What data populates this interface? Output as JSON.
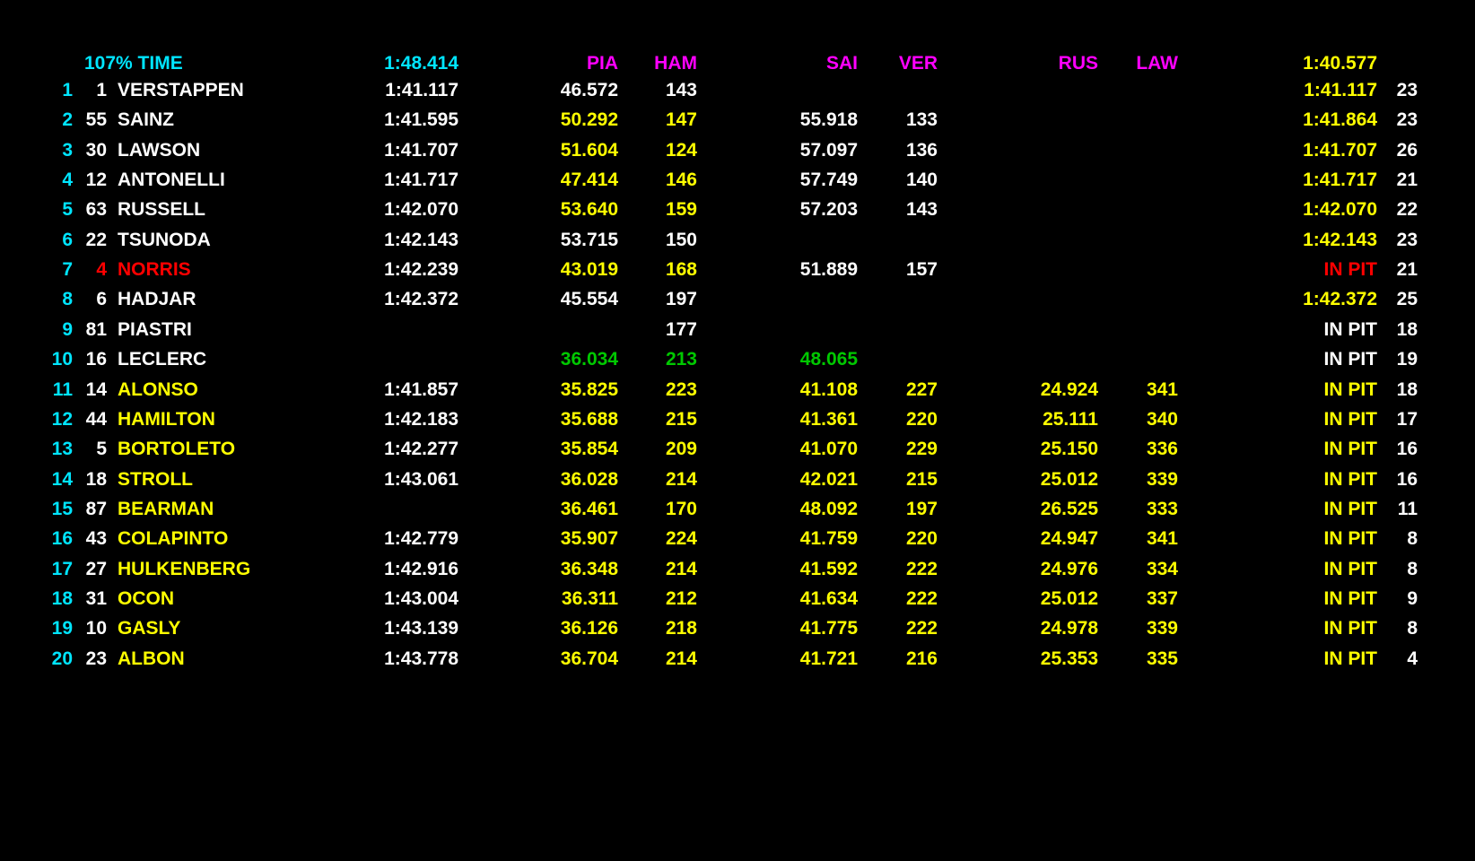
{
  "colors": {
    "white": "#ffffff",
    "yellow": "#ffff00",
    "cyan": "#00e5ff",
    "magenta": "#ff00ff",
    "red": "#ff0000",
    "green": "#00c800"
  },
  "header": {
    "title": "107% TIME",
    "lap_time": "1:48.414",
    "s1_driver": "PIA",
    "s1_speed_driver": "HAM",
    "s2_driver": "SAI",
    "s2_speed_driver": "VER",
    "s3_driver": "RUS",
    "s3_speed_driver": "LAW",
    "best_time": "1:40.577"
  },
  "rows": [
    {
      "pos": "1",
      "num": "1",
      "name": "VERSTAPPEN",
      "lap": "1:41.117",
      "s1": "46.572",
      "s1s": "143",
      "s2": "",
      "s2s": "",
      "s3": "",
      "s3s": "",
      "best": "1:41.117",
      "laps": "23",
      "c": {
        "name": "white",
        "lap": "white",
        "s1": "white",
        "s1s": "white",
        "best": "yellow"
      }
    },
    {
      "pos": "2",
      "num": "55",
      "name": "SAINZ",
      "lap": "1:41.595",
      "s1": "50.292",
      "s1s": "147",
      "s2": "55.918",
      "s2s": "133",
      "s3": "",
      "s3s": "",
      "best": "1:41.864",
      "laps": "23",
      "c": {
        "name": "white",
        "lap": "white",
        "s1": "yellow",
        "s1s": "yellow",
        "s2": "white",
        "s2s": "white",
        "best": "yellow"
      }
    },
    {
      "pos": "3",
      "num": "30",
      "name": "LAWSON",
      "lap": "1:41.707",
      "s1": "51.604",
      "s1s": "124",
      "s2": "57.097",
      "s2s": "136",
      "s3": "",
      "s3s": "",
      "best": "1:41.707",
      "laps": "26",
      "c": {
        "name": "white",
        "lap": "white",
        "s1": "yellow",
        "s1s": "yellow",
        "s2": "white",
        "s2s": "white",
        "best": "yellow"
      }
    },
    {
      "pos": "4",
      "num": "12",
      "name": "ANTONELLI",
      "lap": "1:41.717",
      "s1": "47.414",
      "s1s": "146",
      "s2": "57.749",
      "s2s": "140",
      "s3": "",
      "s3s": "",
      "best": "1:41.717",
      "laps": "21",
      "c": {
        "name": "white",
        "lap": "white",
        "s1": "yellow",
        "s1s": "yellow",
        "s2": "white",
        "s2s": "white",
        "best": "yellow"
      }
    },
    {
      "pos": "5",
      "num": "63",
      "name": "RUSSELL",
      "lap": "1:42.070",
      "s1": "53.640",
      "s1s": "159",
      "s2": "57.203",
      "s2s": "143",
      "s3": "",
      "s3s": "",
      "best": "1:42.070",
      "laps": "22",
      "c": {
        "name": "white",
        "lap": "white",
        "s1": "yellow",
        "s1s": "yellow",
        "s2": "white",
        "s2s": "white",
        "best": "yellow"
      }
    },
    {
      "pos": "6",
      "num": "22",
      "name": "TSUNODA",
      "lap": "1:42.143",
      "s1": "53.715",
      "s1s": "150",
      "s2": "",
      "s2s": "",
      "s3": "",
      "s3s": "",
      "best": "1:42.143",
      "laps": "23",
      "c": {
        "name": "white",
        "lap": "white",
        "s1": "white",
        "s1s": "white",
        "best": "yellow"
      }
    },
    {
      "pos": "7",
      "num": "4",
      "name": "NORRIS",
      "lap": "1:42.239",
      "s1": "43.019",
      "s1s": "168",
      "s2": "51.889",
      "s2s": "157",
      "s3": "",
      "s3s": "",
      "best": "IN PIT",
      "laps": "21",
      "c": {
        "num": "red",
        "name": "red",
        "lap": "white",
        "s1": "yellow",
        "s1s": "yellow",
        "s2": "white",
        "s2s": "white",
        "best": "red"
      }
    },
    {
      "pos": "8",
      "num": "6",
      "name": "HADJAR",
      "lap": "1:42.372",
      "s1": "45.554",
      "s1s": "197",
      "s2": "",
      "s2s": "",
      "s3": "",
      "s3s": "",
      "best": "1:42.372",
      "laps": "25",
      "c": {
        "name": "white",
        "lap": "white",
        "s1": "white",
        "s1s": "white",
        "best": "yellow"
      }
    },
    {
      "pos": "9",
      "num": "81",
      "name": "PIASTRI",
      "lap": "",
      "s1": "",
      "s1s": "177",
      "s2": "",
      "s2s": "",
      "s3": "",
      "s3s": "",
      "best": "IN PIT",
      "laps": "18",
      "c": {
        "name": "white",
        "s1s": "white",
        "best": "white"
      }
    },
    {
      "pos": "10",
      "num": "16",
      "name": "LECLERC",
      "lap": "",
      "s1": "36.034",
      "s1s": "213",
      "s2": "48.065",
      "s2s": "",
      "s3": "",
      "s3s": "",
      "best": "IN PIT",
      "laps": "19",
      "c": {
        "name": "white",
        "s1": "green",
        "s1s": "green",
        "s2": "green",
        "best": "white"
      }
    },
    {
      "pos": "11",
      "num": "14",
      "name": "ALONSO",
      "lap": "1:41.857",
      "s1": "35.825",
      "s1s": "223",
      "s2": "41.108",
      "s2s": "227",
      "s3": "24.924",
      "s3s": "341",
      "best": "IN PIT",
      "laps": "18",
      "c": {
        "name": "yellow",
        "lap": "white",
        "s1": "yellow",
        "s1s": "yellow",
        "s2": "yellow",
        "s2s": "yellow",
        "s3": "yellow",
        "s3s": "yellow",
        "best": "yellow"
      }
    },
    {
      "pos": "12",
      "num": "44",
      "name": "HAMILTON",
      "lap": "1:42.183",
      "s1": "35.688",
      "s1s": "215",
      "s2": "41.361",
      "s2s": "220",
      "s3": "25.111",
      "s3s": "340",
      "best": "IN PIT",
      "laps": "17",
      "c": {
        "name": "yellow",
        "lap": "white",
        "s1": "yellow",
        "s1s": "yellow",
        "s2": "yellow",
        "s2s": "yellow",
        "s3": "yellow",
        "s3s": "yellow",
        "best": "yellow"
      }
    },
    {
      "pos": "13",
      "num": "5",
      "name": "BORTOLETO",
      "lap": "1:42.277",
      "s1": "35.854",
      "s1s": "209",
      "s2": "41.070",
      "s2s": "229",
      "s3": "25.150",
      "s3s": "336",
      "best": "IN PIT",
      "laps": "16",
      "c": {
        "name": "yellow",
        "lap": "white",
        "s1": "yellow",
        "s1s": "yellow",
        "s2": "yellow",
        "s2s": "yellow",
        "s3": "yellow",
        "s3s": "yellow",
        "best": "yellow"
      }
    },
    {
      "pos": "14",
      "num": "18",
      "name": "STROLL",
      "lap": "1:43.061",
      "s1": "36.028",
      "s1s": "214",
      "s2": "42.021",
      "s2s": "215",
      "s3": "25.012",
      "s3s": "339",
      "best": "IN PIT",
      "laps": "16",
      "c": {
        "name": "yellow",
        "lap": "white",
        "s1": "yellow",
        "s1s": "yellow",
        "s2": "yellow",
        "s2s": "yellow",
        "s3": "yellow",
        "s3s": "yellow",
        "best": "yellow"
      }
    },
    {
      "pos": "15",
      "num": "87",
      "name": "BEARMAN",
      "lap": "",
      "s1": "36.461",
      "s1s": "170",
      "s2": "48.092",
      "s2s": "197",
      "s3": "26.525",
      "s3s": "333",
      "best": "IN PIT",
      "laps": "11",
      "c": {
        "name": "yellow",
        "s1": "yellow",
        "s1s": "yellow",
        "s2": "yellow",
        "s2s": "yellow",
        "s3": "yellow",
        "s3s": "yellow",
        "best": "yellow"
      }
    },
    {
      "pos": "16",
      "num": "43",
      "name": "COLAPINTO",
      "lap": "1:42.779",
      "s1": "35.907",
      "s1s": "224",
      "s2": "41.759",
      "s2s": "220",
      "s3": "24.947",
      "s3s": "341",
      "best": "IN PIT",
      "laps": "8",
      "c": {
        "name": "yellow",
        "lap": "white",
        "s1": "yellow",
        "s1s": "yellow",
        "s2": "yellow",
        "s2s": "yellow",
        "s3": "yellow",
        "s3s": "yellow",
        "best": "yellow"
      }
    },
    {
      "pos": "17",
      "num": "27",
      "name": "HULKENBERG",
      "lap": "1:42.916",
      "s1": "36.348",
      "s1s": "214",
      "s2": "41.592",
      "s2s": "222",
      "s3": "24.976",
      "s3s": "334",
      "best": "IN PIT",
      "laps": "8",
      "c": {
        "name": "yellow",
        "lap": "white",
        "s1": "yellow",
        "s1s": "yellow",
        "s2": "yellow",
        "s2s": "yellow",
        "s3": "yellow",
        "s3s": "yellow",
        "best": "yellow"
      }
    },
    {
      "pos": "18",
      "num": "31",
      "name": "OCON",
      "lap": "1:43.004",
      "s1": "36.311",
      "s1s": "212",
      "s2": "41.634",
      "s2s": "222",
      "s3": "25.012",
      "s3s": "337",
      "best": "IN PIT",
      "laps": "9",
      "c": {
        "name": "yellow",
        "lap": "white",
        "s1": "yellow",
        "s1s": "yellow",
        "s2": "yellow",
        "s2s": "yellow",
        "s3": "yellow",
        "s3s": "yellow",
        "best": "yellow"
      }
    },
    {
      "pos": "19",
      "num": "10",
      "name": "GASLY",
      "lap": "1:43.139",
      "s1": "36.126",
      "s1s": "218",
      "s2": "41.775",
      "s2s": "222",
      "s3": "24.978",
      "s3s": "339",
      "best": "IN PIT",
      "laps": "8",
      "c": {
        "name": "yellow",
        "lap": "white",
        "s1": "yellow",
        "s1s": "yellow",
        "s2": "yellow",
        "s2s": "yellow",
        "s3": "yellow",
        "s3s": "yellow",
        "best": "yellow"
      }
    },
    {
      "pos": "20",
      "num": "23",
      "name": "ALBON",
      "lap": "1:43.778",
      "s1": "36.704",
      "s1s": "214",
      "s2": "41.721",
      "s2s": "216",
      "s3": "25.353",
      "s3s": "335",
      "best": "IN PIT",
      "laps": "4",
      "c": {
        "name": "yellow",
        "lap": "white",
        "s1": "yellow",
        "s1s": "yellow",
        "s2": "yellow",
        "s2s": "yellow",
        "s3": "yellow",
        "s3s": "yellow",
        "best": "yellow"
      }
    }
  ]
}
